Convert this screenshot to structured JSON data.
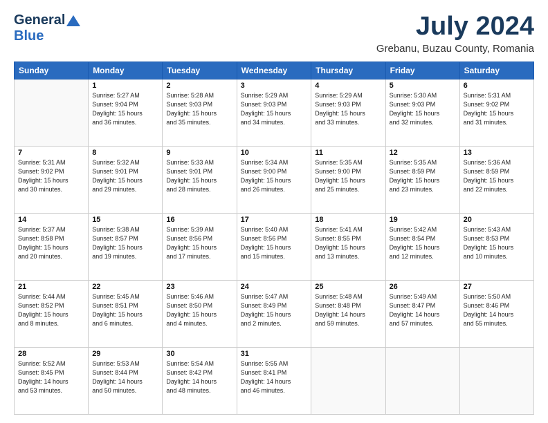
{
  "header": {
    "logo_line1": "General",
    "logo_line2": "Blue",
    "month": "July 2024",
    "location": "Grebanu, Buzau County, Romania"
  },
  "weekdays": [
    "Sunday",
    "Monday",
    "Tuesday",
    "Wednesday",
    "Thursday",
    "Friday",
    "Saturday"
  ],
  "weeks": [
    [
      {
        "day": "",
        "info": ""
      },
      {
        "day": "1",
        "info": "Sunrise: 5:27 AM\nSunset: 9:04 PM\nDaylight: 15 hours\nand 36 minutes."
      },
      {
        "day": "2",
        "info": "Sunrise: 5:28 AM\nSunset: 9:03 PM\nDaylight: 15 hours\nand 35 minutes."
      },
      {
        "day": "3",
        "info": "Sunrise: 5:29 AM\nSunset: 9:03 PM\nDaylight: 15 hours\nand 34 minutes."
      },
      {
        "day": "4",
        "info": "Sunrise: 5:29 AM\nSunset: 9:03 PM\nDaylight: 15 hours\nand 33 minutes."
      },
      {
        "day": "5",
        "info": "Sunrise: 5:30 AM\nSunset: 9:03 PM\nDaylight: 15 hours\nand 32 minutes."
      },
      {
        "day": "6",
        "info": "Sunrise: 5:31 AM\nSunset: 9:02 PM\nDaylight: 15 hours\nand 31 minutes."
      }
    ],
    [
      {
        "day": "7",
        "info": "Sunrise: 5:31 AM\nSunset: 9:02 PM\nDaylight: 15 hours\nand 30 minutes."
      },
      {
        "day": "8",
        "info": "Sunrise: 5:32 AM\nSunset: 9:01 PM\nDaylight: 15 hours\nand 29 minutes."
      },
      {
        "day": "9",
        "info": "Sunrise: 5:33 AM\nSunset: 9:01 PM\nDaylight: 15 hours\nand 28 minutes."
      },
      {
        "day": "10",
        "info": "Sunrise: 5:34 AM\nSunset: 9:00 PM\nDaylight: 15 hours\nand 26 minutes."
      },
      {
        "day": "11",
        "info": "Sunrise: 5:35 AM\nSunset: 9:00 PM\nDaylight: 15 hours\nand 25 minutes."
      },
      {
        "day": "12",
        "info": "Sunrise: 5:35 AM\nSunset: 8:59 PM\nDaylight: 15 hours\nand 23 minutes."
      },
      {
        "day": "13",
        "info": "Sunrise: 5:36 AM\nSunset: 8:59 PM\nDaylight: 15 hours\nand 22 minutes."
      }
    ],
    [
      {
        "day": "14",
        "info": "Sunrise: 5:37 AM\nSunset: 8:58 PM\nDaylight: 15 hours\nand 20 minutes."
      },
      {
        "day": "15",
        "info": "Sunrise: 5:38 AM\nSunset: 8:57 PM\nDaylight: 15 hours\nand 19 minutes."
      },
      {
        "day": "16",
        "info": "Sunrise: 5:39 AM\nSunset: 8:56 PM\nDaylight: 15 hours\nand 17 minutes."
      },
      {
        "day": "17",
        "info": "Sunrise: 5:40 AM\nSunset: 8:56 PM\nDaylight: 15 hours\nand 15 minutes."
      },
      {
        "day": "18",
        "info": "Sunrise: 5:41 AM\nSunset: 8:55 PM\nDaylight: 15 hours\nand 13 minutes."
      },
      {
        "day": "19",
        "info": "Sunrise: 5:42 AM\nSunset: 8:54 PM\nDaylight: 15 hours\nand 12 minutes."
      },
      {
        "day": "20",
        "info": "Sunrise: 5:43 AM\nSunset: 8:53 PM\nDaylight: 15 hours\nand 10 minutes."
      }
    ],
    [
      {
        "day": "21",
        "info": "Sunrise: 5:44 AM\nSunset: 8:52 PM\nDaylight: 15 hours\nand 8 minutes."
      },
      {
        "day": "22",
        "info": "Sunrise: 5:45 AM\nSunset: 8:51 PM\nDaylight: 15 hours\nand 6 minutes."
      },
      {
        "day": "23",
        "info": "Sunrise: 5:46 AM\nSunset: 8:50 PM\nDaylight: 15 hours\nand 4 minutes."
      },
      {
        "day": "24",
        "info": "Sunrise: 5:47 AM\nSunset: 8:49 PM\nDaylight: 15 hours\nand 2 minutes."
      },
      {
        "day": "25",
        "info": "Sunrise: 5:48 AM\nSunset: 8:48 PM\nDaylight: 14 hours\nand 59 minutes."
      },
      {
        "day": "26",
        "info": "Sunrise: 5:49 AM\nSunset: 8:47 PM\nDaylight: 14 hours\nand 57 minutes."
      },
      {
        "day": "27",
        "info": "Sunrise: 5:50 AM\nSunset: 8:46 PM\nDaylight: 14 hours\nand 55 minutes."
      }
    ],
    [
      {
        "day": "28",
        "info": "Sunrise: 5:52 AM\nSunset: 8:45 PM\nDaylight: 14 hours\nand 53 minutes."
      },
      {
        "day": "29",
        "info": "Sunrise: 5:53 AM\nSunset: 8:44 PM\nDaylight: 14 hours\nand 50 minutes."
      },
      {
        "day": "30",
        "info": "Sunrise: 5:54 AM\nSunset: 8:42 PM\nDaylight: 14 hours\nand 48 minutes."
      },
      {
        "day": "31",
        "info": "Sunrise: 5:55 AM\nSunset: 8:41 PM\nDaylight: 14 hours\nand 46 minutes."
      },
      {
        "day": "",
        "info": ""
      },
      {
        "day": "",
        "info": ""
      },
      {
        "day": "",
        "info": ""
      }
    ]
  ]
}
